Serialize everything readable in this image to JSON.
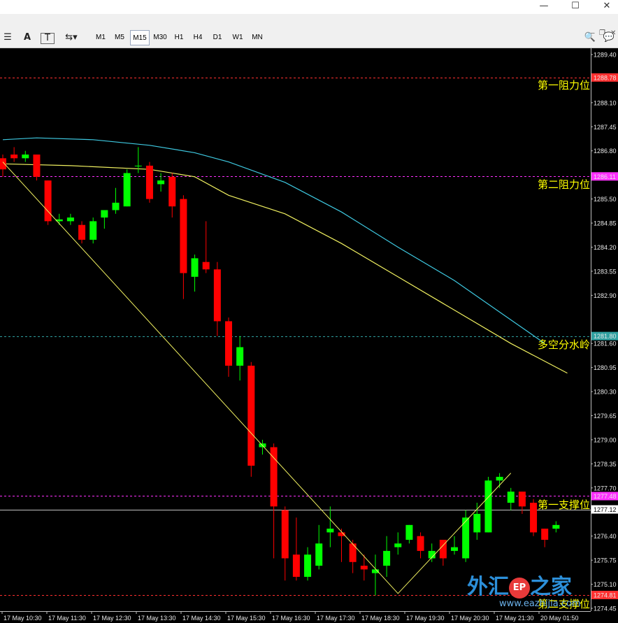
{
  "window": {
    "minimize": "—",
    "maximize": "☐",
    "close": "✕"
  },
  "toolbar": {
    "icons": [
      {
        "name": "menu-icon",
        "glyph": "☰"
      },
      {
        "name": "text-icon",
        "glyph": "A"
      },
      {
        "name": "text-label-icon",
        "glyph": "T"
      },
      {
        "name": "arrows-icon",
        "glyph": "⇆▾"
      }
    ],
    "timeframes": [
      "M1",
      "M5",
      "M15",
      "M30",
      "H1",
      "H4",
      "D1",
      "W1",
      "MN"
    ],
    "active_timeframe": "M15",
    "search_icon": "🔍",
    "chat_icon": "💬"
  },
  "levels": {
    "r1_label": "第一阻力位",
    "r2_label": "第二阻力位",
    "pivot_label": "多空分水岭",
    "s1_label": "第一支撑位",
    "s2_label": "第二支撑位"
  },
  "watermark": {
    "text": "外汇之家",
    "url": "www.eazhijia.com",
    "badge": "EP"
  },
  "chart_data": {
    "type": "candlestick",
    "y_ticks": [
      "1289.40",
      "1288.78",
      "1288.10",
      "1287.45",
      "1286.80",
      "1286.11",
      "1285.50",
      "1284.85",
      "1284.20",
      "1283.55",
      "1282.90",
      "1281.80",
      "1281.60",
      "1280.95",
      "1280.30",
      "1279.65",
      "1279.00",
      "1278.35",
      "1277.70",
      "1277.48",
      "1277.12",
      "1276.40",
      "1275.75",
      "1275.10",
      "1274.81",
      "1274.45"
    ],
    "x_ticks": [
      "17 May 10:30",
      "17 May 11:30",
      "17 May 12:30",
      "17 May 13:30",
      "17 May 14:30",
      "17 May 15:30",
      "17 May 16:30",
      "17 May 17:30",
      "17 May 18:30",
      "17 May 19:30",
      "17 May 20:30",
      "17 May 21:30",
      "20 May 01:50"
    ],
    "levels": [
      {
        "name": "第一阻力位",
        "price": 1288.78,
        "color": "#ff3030",
        "style": "dashed"
      },
      {
        "name": "第二阻力位",
        "price": 1286.11,
        "color": "#ff30ff",
        "style": "dashed"
      },
      {
        "name": "多空分水岭",
        "price": 1281.8,
        "color": "#30a0a0",
        "style": "dashed"
      },
      {
        "name": "第一支撑位",
        "price": 1277.48,
        "color": "#ff30ff",
        "style": "dashed"
      },
      {
        "name": "第二支撑位",
        "price": 1274.81,
        "color": "#ff3030",
        "style": "dashed"
      }
    ],
    "current_price": 1277.12,
    "candles": [
      [
        1286.6,
        1286.3,
        1286.7,
        1286.1
      ],
      [
        1286.7,
        1286.6,
        1286.9,
        1286.5
      ],
      [
        1286.6,
        1286.7,
        1286.8,
        1286.5
      ],
      [
        1286.7,
        1286.1,
        1286.7,
        1286.0
      ],
      [
        1286.0,
        1284.9,
        1286.0,
        1284.8
      ],
      [
        1284.9,
        1284.95,
        1285.1,
        1284.8
      ],
      [
        1284.9,
        1285.0,
        1285.1,
        1284.8
      ],
      [
        1284.8,
        1284.4,
        1284.9,
        1284.3
      ],
      [
        1284.4,
        1284.9,
        1285.0,
        1284.3
      ],
      [
        1285.0,
        1285.2,
        1285.2,
        1284.7
      ],
      [
        1285.2,
        1285.4,
        1285.8,
        1285.1
      ],
      [
        1285.3,
        1286.2,
        1286.3,
        1285.3
      ],
      [
        1286.4,
        1286.4,
        1286.9,
        1286.2
      ],
      [
        1286.4,
        1285.5,
        1286.5,
        1285.4
      ],
      [
        1285.9,
        1286.0,
        1286.2,
        1285.7
      ],
      [
        1286.1,
        1285.3,
        1286.2,
        1285.0
      ],
      [
        1285.5,
        1283.5,
        1285.6,
        1282.8
      ],
      [
        1283.4,
        1283.9,
        1284.0,
        1283.0
      ],
      [
        1283.8,
        1283.6,
        1284.9,
        1283.5
      ],
      [
        1283.6,
        1282.2,
        1283.8,
        1281.8
      ],
      [
        1282.2,
        1281.0,
        1282.3,
        1280.7
      ],
      [
        1281.0,
        1281.5,
        1281.8,
        1280.6
      ],
      [
        1281.0,
        1278.3,
        1281.1,
        1278.0
      ],
      [
        1278.8,
        1278.9,
        1279.0,
        1278.6
      ],
      [
        1278.8,
        1277.2,
        1278.9,
        1275.8
      ],
      [
        1277.1,
        1275.8,
        1277.2,
        1275.2
      ],
      [
        1275.9,
        1275.3,
        1276.9,
        1275.2
      ],
      [
        1275.3,
        1275.9,
        1276.1,
        1275.2
      ],
      [
        1275.6,
        1276.2,
        1276.7,
        1275.5
      ],
      [
        1276.5,
        1276.6,
        1277.2,
        1276.1
      ],
      [
        1276.5,
        1276.4,
        1276.6,
        1275.7
      ],
      [
        1276.2,
        1275.7,
        1276.3,
        1275.4
      ],
      [
        1275.6,
        1275.5,
        1275.9,
        1275.2
      ],
      [
        1275.4,
        1275.5,
        1275.9,
        1274.8
      ],
      [
        1275.6,
        1276.0,
        1276.4,
        1275.3
      ],
      [
        1276.1,
        1276.2,
        1276.5,
        1275.9
      ],
      [
        1276.3,
        1276.7,
        1276.7,
        1276.2
      ],
      [
        1276.4,
        1276.0,
        1276.5,
        1275.8
      ],
      [
        1275.8,
        1276.0,
        1276.2,
        1275.7
      ],
      [
        1276.3,
        1275.8,
        1276.3,
        1275.6
      ],
      [
        1276.0,
        1276.1,
        1276.4,
        1275.9
      ],
      [
        1275.8,
        1276.9,
        1277.1,
        1275.7
      ],
      [
        1276.5,
        1277.0,
        1277.3,
        1276.3
      ],
      [
        1276.5,
        1277.9,
        1278.0,
        1276.5
      ],
      [
        1277.9,
        1278.0,
        1278.1,
        1277.7
      ],
      [
        1277.3,
        1277.6,
        1277.7,
        1277.1
      ],
      [
        1277.6,
        1277.2,
        1277.6,
        1277.0
      ],
      [
        1277.3,
        1276.5,
        1277.4,
        1276.4
      ],
      [
        1276.6,
        1276.3,
        1276.6,
        1276.1
      ],
      [
        1276.6,
        1276.7,
        1276.8,
        1276.5
      ]
    ],
    "ma_fast": [
      [
        0,
        1286.45
      ],
      [
        6,
        1286.4
      ],
      [
        13,
        1286.3
      ],
      [
        17,
        1286.1
      ],
      [
        20,
        1285.6
      ],
      [
        25,
        1285.1
      ],
      [
        30,
        1284.3
      ],
      [
        35,
        1283.4
      ],
      [
        40,
        1282.5
      ],
      [
        45,
        1281.6
      ],
      [
        50,
        1280.8
      ]
    ],
    "ma_slow": [
      [
        0,
        1287.1
      ],
      [
        3,
        1287.15
      ],
      [
        8,
        1287.1
      ],
      [
        13,
        1286.95
      ],
      [
        17,
        1286.75
      ],
      [
        20,
        1286.5
      ],
      [
        25,
        1285.95
      ],
      [
        30,
        1285.15
      ],
      [
        35,
        1284.2
      ],
      [
        40,
        1283.3
      ],
      [
        44,
        1282.45
      ],
      [
        48,
        1281.6
      ]
    ],
    "zigzag": [
      [
        0,
        1286.5
      ],
      [
        35,
        1274.85
      ],
      [
        45,
        1278.1
      ]
    ]
  }
}
